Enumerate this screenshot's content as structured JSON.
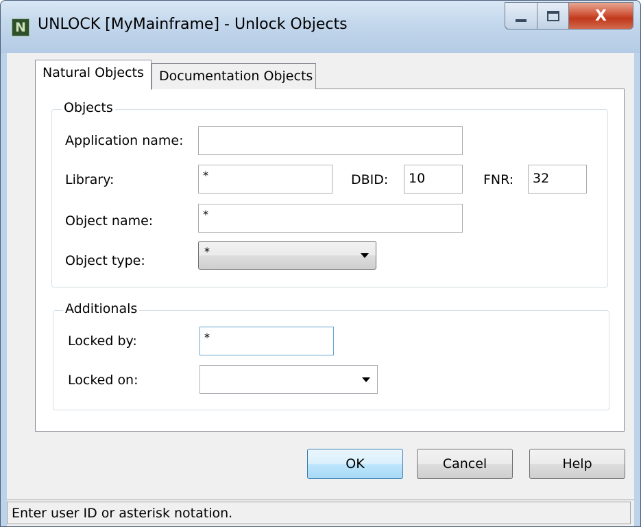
{
  "window": {
    "title": "UNLOCK [MyMainframe] - Unlock Objects",
    "icon_letter": "N",
    "close_glyph": "X"
  },
  "tabs": [
    {
      "label": "Natural Objects",
      "active": true
    },
    {
      "label": "Documentation Objects",
      "active": false
    }
  ],
  "objects_group": {
    "title": "Objects",
    "application_name": {
      "label": "Application name:",
      "value": ""
    },
    "library": {
      "label": "Library:",
      "value": "*"
    },
    "dbid": {
      "label": "DBID:",
      "value": "10"
    },
    "fnr": {
      "label": "FNR:",
      "value": "32"
    },
    "object_name": {
      "label": "Object name:",
      "value": "*"
    },
    "object_type": {
      "label": "Object type:",
      "value": "*"
    }
  },
  "additionals_group": {
    "title": "Additionals",
    "locked_by": {
      "label": "Locked by:",
      "value": "*"
    },
    "locked_on": {
      "label": "Locked on:",
      "value": ""
    }
  },
  "buttons": {
    "ok": "OK",
    "cancel": "Cancel",
    "help": "Help"
  },
  "status": "Enter user ID or asterisk notation."
}
